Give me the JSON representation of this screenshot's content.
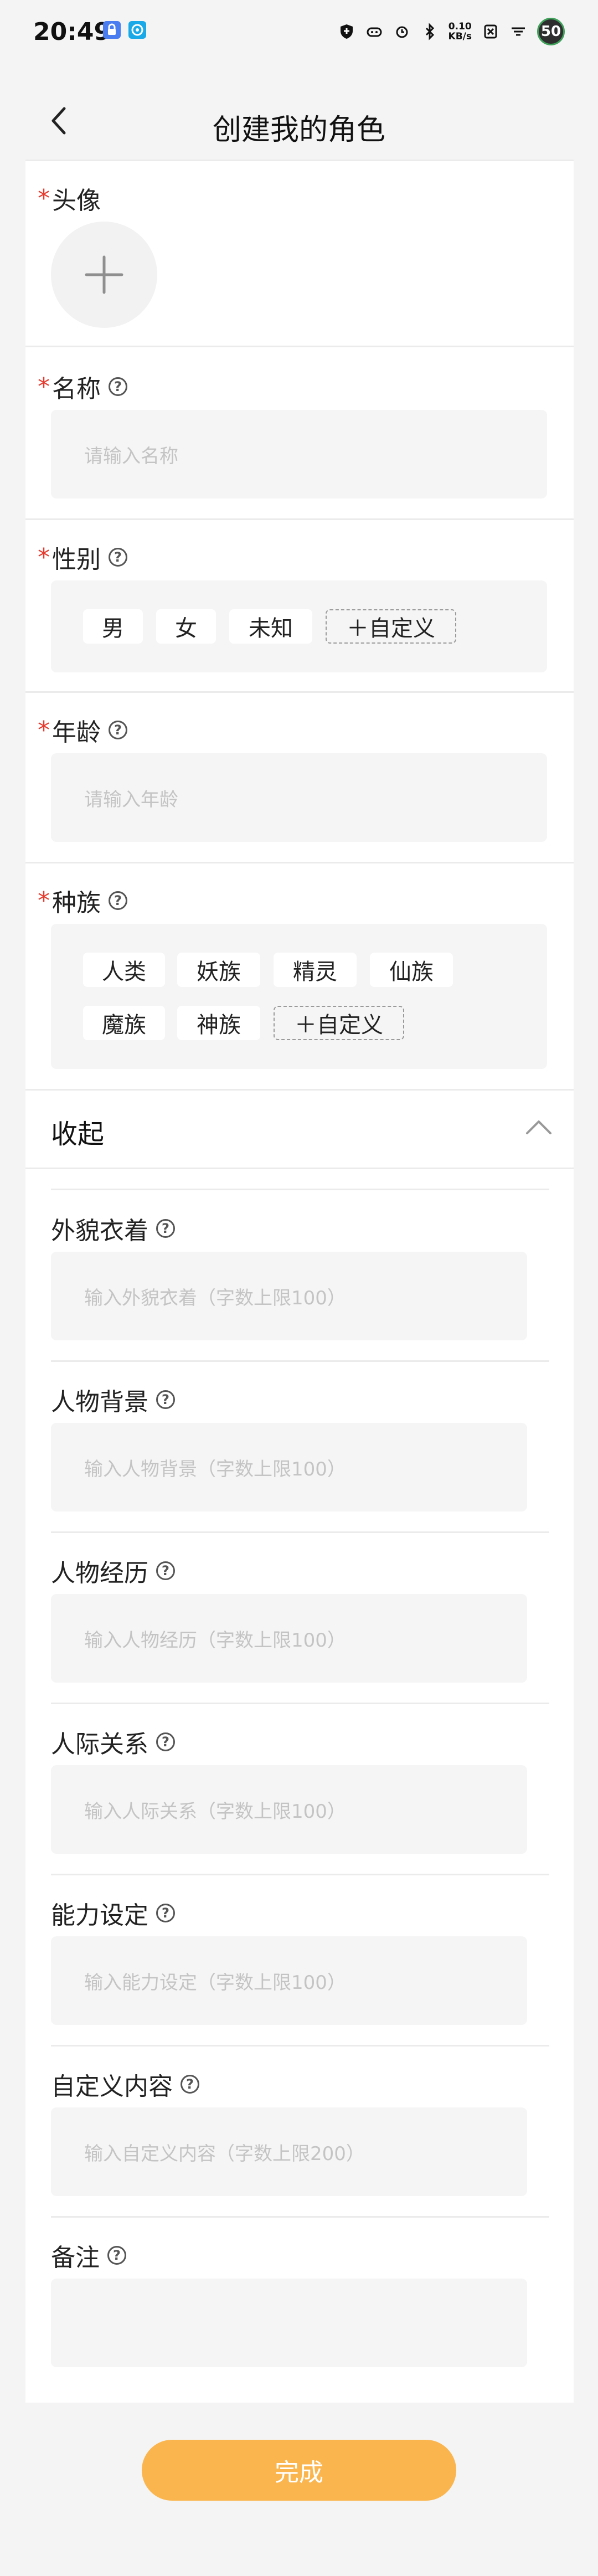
{
  "status_bar": {
    "time": "20:49",
    "net_speed_value": "0.10",
    "net_speed_unit": "KB/s",
    "battery": "50"
  },
  "header": {
    "title": "创建我的角色"
  },
  "required_mark": "*",
  "help_glyph": "?",
  "avatar": {
    "label": "头像"
  },
  "name": {
    "label": "名称",
    "placeholder": "请输入名称"
  },
  "gender": {
    "label": "性别",
    "options": [
      "男",
      "女",
      "未知"
    ],
    "custom": "＋自定义"
  },
  "age": {
    "label": "年龄",
    "placeholder": "请输入年龄"
  },
  "race": {
    "label": "种族",
    "options": [
      "人类",
      "妖族",
      "精灵",
      "仙族",
      "魔族",
      "神族"
    ],
    "custom": "＋自定义"
  },
  "collapse": {
    "label": "收起"
  },
  "optional_fields": [
    {
      "label": "外貌衣着",
      "placeholder": "输入外貌衣着（字数上限100）"
    },
    {
      "label": "人物背景",
      "placeholder": "输入人物背景（字数上限100）"
    },
    {
      "label": "人物经历",
      "placeholder": "输入人物经历（字数上限100）"
    },
    {
      "label": "人际关系",
      "placeholder": "输入人际关系（字数上限100）"
    },
    {
      "label": "能力设定",
      "placeholder": "输入能力设定（字数上限100）"
    },
    {
      "label": "自定义内容",
      "placeholder": "输入自定义内容（字数上限200）"
    },
    {
      "label": "备注",
      "placeholder": ""
    }
  ],
  "done_button": "完成",
  "colors": {
    "accent": "#fbb54e",
    "required": "#e63c2f"
  }
}
